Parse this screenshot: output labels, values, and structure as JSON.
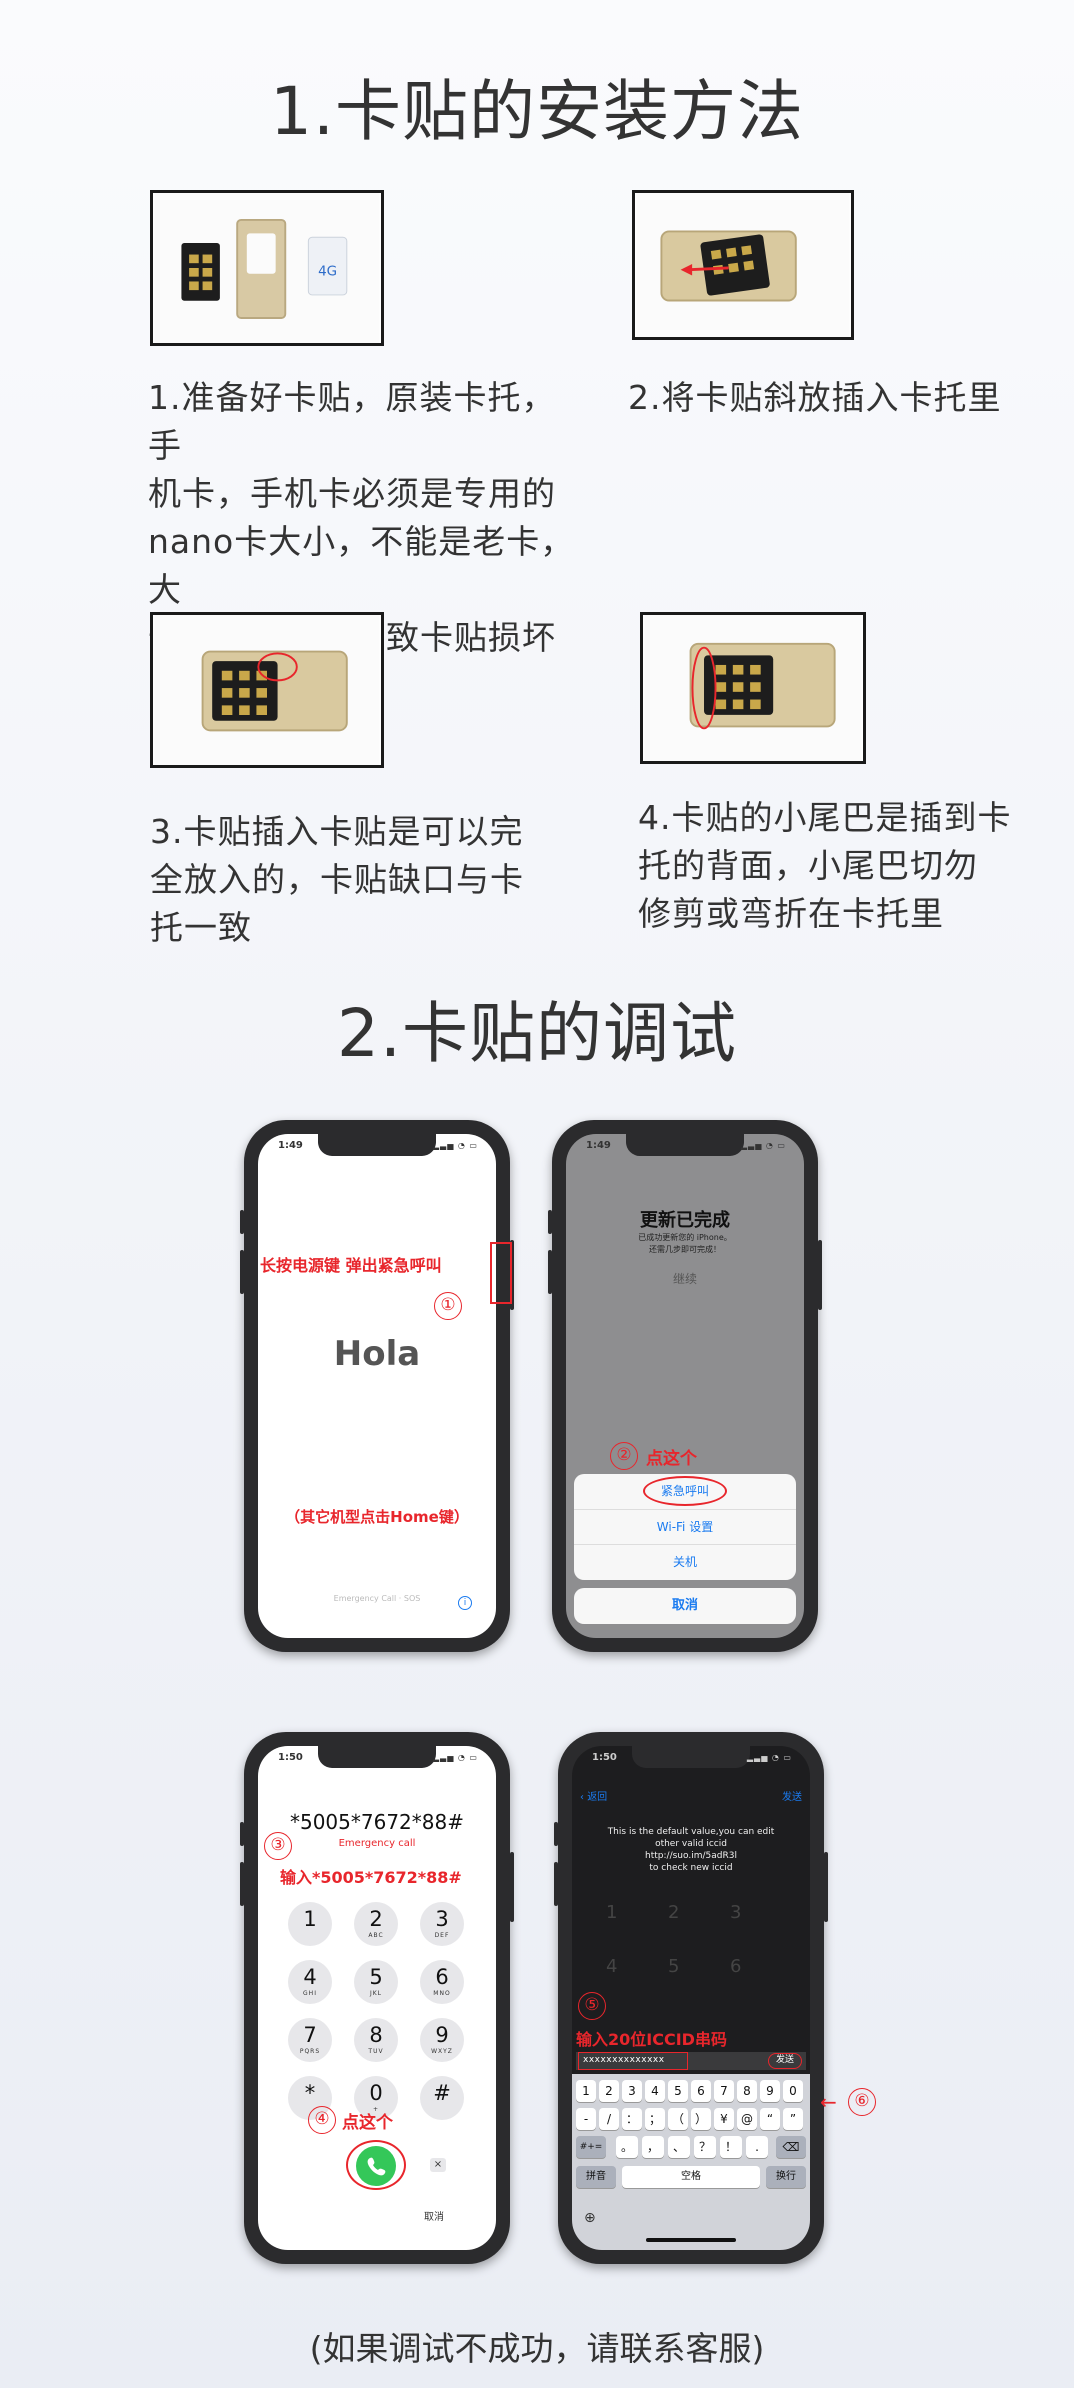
{
  "section1": {
    "title": "1.卡贴的安装方法",
    "steps": [
      {
        "lines": [
          "1.准备好卡贴，原装卡托，手",
          "机卡，手机卡必须是专用的",
          "nano卡大小，不能是老卡，大",
          "卡剪成，否则导致卡贴损坏"
        ]
      },
      {
        "lines": [
          "2.将卡贴斜放插入卡托里"
        ]
      },
      {
        "lines": [
          "3.卡贴插入卡贴是可以完",
          "全放入的，卡贴缺口与卡",
          "托一致"
        ]
      },
      {
        "lines": [
          "4.卡贴的小尾巴是插到卡",
          "托的背面，小尾巴切勿",
          "修剪或弯折在卡托里"
        ]
      }
    ],
    "sim_label": "4G"
  },
  "section2": {
    "title": "2.卡贴的调试",
    "phone1": {
      "time": "1:49",
      "annotation": "长按电源键 弹出紧急呼叫",
      "badge": "①",
      "hello": "Hola",
      "note": "（其它机型点击Home键）",
      "bottom_text": "Emergency Call · SOS",
      "info": "i"
    },
    "phone2": {
      "time": "1:49",
      "heading": "更新已完成",
      "sub1": "已成功更新您的 iPhone。",
      "sub2": "还需几步即可完成！",
      "continue": "继续",
      "badge": "②",
      "annotation": "点这个",
      "items": [
        "紧急呼叫",
        "Wi-Fi 设置",
        "关机"
      ],
      "cancel": "取消"
    },
    "phone3": {
      "time": "1:50",
      "number": "*5005*7672*88#",
      "emergency": "Emergency call",
      "badge": "③",
      "annotation": "输入*5005*7672*88#",
      "keys": [
        {
          "n": "1",
          "l": ""
        },
        {
          "n": "2",
          "l": "ABC"
        },
        {
          "n": "3",
          "l": "DEF"
        },
        {
          "n": "4",
          "l": "GHI"
        },
        {
          "n": "5",
          "l": "JKL"
        },
        {
          "n": "6",
          "l": "MNO"
        },
        {
          "n": "7",
          "l": "PQRS"
        },
        {
          "n": "8",
          "l": "TUV"
        },
        {
          "n": "9",
          "l": "WXYZ"
        },
        {
          "n": "*",
          "l": ""
        },
        {
          "n": "0",
          "l": "+"
        },
        {
          "n": "#",
          "l": ""
        }
      ],
      "badge4": "④",
      "annotation4": "点这个",
      "delete": "×",
      "cancel": "取消"
    },
    "phone4": {
      "time": "1:50",
      "back": "返回",
      "send_top": "发送",
      "msg1": "This is the default value,you can edit",
      "msg2": "other valid iccid",
      "msg3": "http://suo.im/5adR3l",
      "msg4": "to check new iccid",
      "badge5": "⑤",
      "annotation5": "输入20位ICCID串码",
      "input": "xxxxxxxxxxxxxx",
      "send": "发送",
      "badge6": "⑥",
      "arrow": "←",
      "row1": [
        "1",
        "2",
        "3",
        "4",
        "5",
        "6",
        "7",
        "8",
        "9",
        "0"
      ],
      "row2": [
        "-",
        "/",
        "：",
        "；",
        "（",
        "）",
        "¥",
        "@",
        "“",
        "”"
      ],
      "row3": [
        "#+=",
        "。",
        "，",
        "、",
        "？",
        "！",
        "."
      ],
      "pinyin": "拼音",
      "space": "空格",
      "return": "换行",
      "globe": "⊕"
    }
  },
  "footer": "(如果调试不成功，请联系客服)"
}
